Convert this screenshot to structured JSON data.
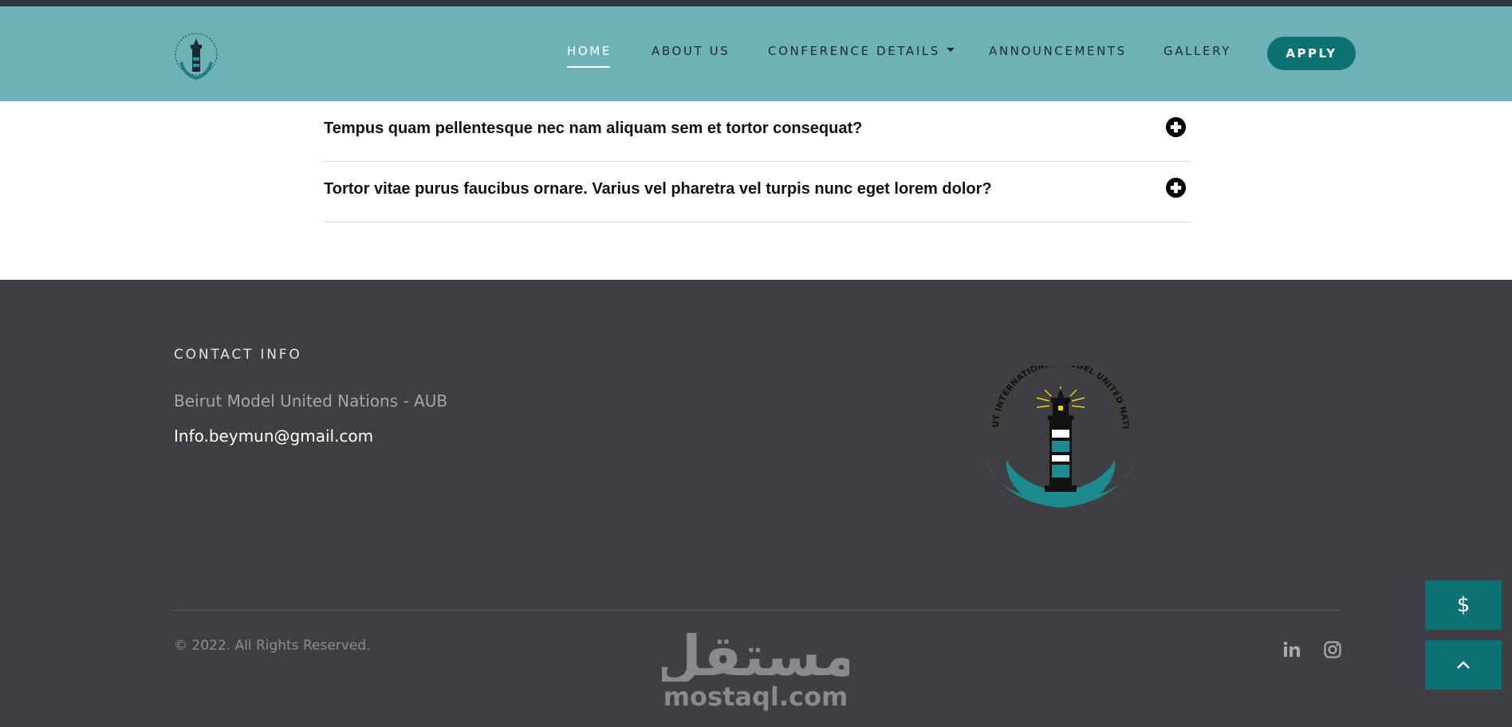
{
  "header": {
    "nav": [
      {
        "label": "HOME",
        "active": true
      },
      {
        "label": "ABOUT US",
        "active": false
      },
      {
        "label": "CONFERENCE DETAILS",
        "active": false,
        "dropdown": true
      },
      {
        "label": "ANNOUNCEMENTS",
        "active": false
      },
      {
        "label": "GALLERY",
        "active": false
      }
    ],
    "apply_label": "APPLY"
  },
  "faq": [
    {
      "question": "Tempus quam pellentesque nec nam aliquam sem et tortor consequat?",
      "icon": "plus-circle-icon"
    },
    {
      "question": "Tortor vitae purus faucibus ornare. Varius vel pharetra vel turpis nunc eget lorem dolor?",
      "icon": "plus-circle-icon"
    }
  ],
  "footer": {
    "contact_title": "CONTACT INFO",
    "organization": "Beirut Model United Nations - AUB",
    "email": "Info.beymun@gmail.com",
    "logo_text": "BEIRUT INTERNATIONAL MODEL UNITED NATIONS",
    "copyright": "© 2022. All Rights Reserved.",
    "social": [
      "linkedin-icon",
      "instagram-icon"
    ]
  },
  "watermark": {
    "arabic": "مستقل",
    "latin": "mostaql.com"
  },
  "floating": {
    "dollar_label": "$"
  },
  "colors": {
    "header_bg": "#6db2b7",
    "accent": "#0e7275",
    "footer_bg": "#3f3e43",
    "topbar": "#2e3640"
  }
}
